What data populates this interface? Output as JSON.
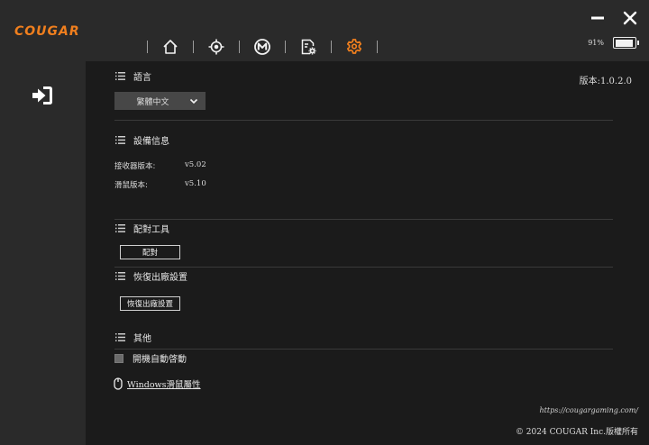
{
  "app": {
    "logo": "COUGAR",
    "version_label": "版本:1.0.2.0"
  },
  "window": {
    "minimize_icon": "minus-icon",
    "close_icon": "close-icon"
  },
  "nav": [
    {
      "name": "home",
      "icon": "home-icon"
    },
    {
      "name": "dpi",
      "icon": "crosshair-icon"
    },
    {
      "name": "macro",
      "icon": "macro-m-icon"
    },
    {
      "name": "profile-settings",
      "icon": "file-gear-icon"
    },
    {
      "name": "settings",
      "icon": "gear-icon",
      "active": true
    }
  ],
  "battery": {
    "percent_text": "91%",
    "level": 0.91
  },
  "colors": {
    "accent": "#f07f1e",
    "background": "#1b1b1b",
    "panel": "#2a2a2a"
  },
  "language": {
    "title": "語言",
    "selected": "繁體中文"
  },
  "device_info": {
    "title": "設備信息",
    "rows": [
      {
        "label": "接收器版本:",
        "value": "v5.02"
      },
      {
        "label": "滑鼠版本:",
        "value": "v5.10"
      }
    ]
  },
  "pairing": {
    "title": "配對工具",
    "button": "配對"
  },
  "factory_reset": {
    "title": "恢復出廠設置",
    "button": "恢復出廠設置"
  },
  "other": {
    "title": "其他",
    "autostart_label": "開機自動啓動",
    "mouse_props_link": "Windows滑鼠屬性"
  },
  "footer": {
    "url": "https://cougargaming.com/",
    "copyright": "© 2024 COUGAR Inc.版權所有"
  }
}
